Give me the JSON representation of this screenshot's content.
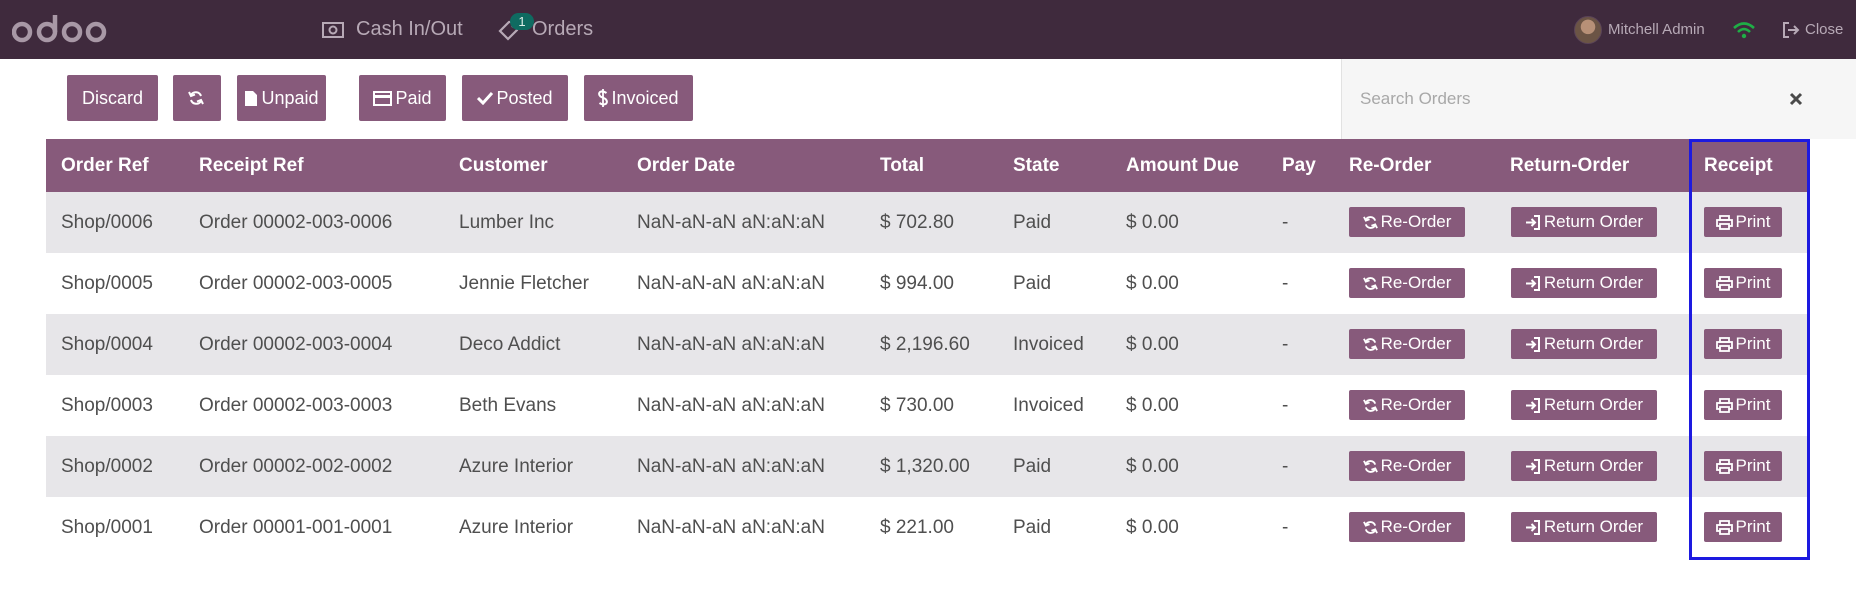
{
  "navbar": {
    "logo_text": "odoo",
    "cash_label": "Cash In/Out",
    "orders_label": "Orders",
    "orders_badge": "1",
    "user_name": "Mitchell Admin",
    "close_label": "Close",
    "colors": {
      "bar": "#3f2a3d",
      "text": "#b7a9b6",
      "wifi": "#1fae46",
      "badge": "#0f6b61"
    }
  },
  "toolbar": {
    "discard_label": "Discard",
    "unpaid_label": "Unpaid",
    "paid_label": "Paid",
    "posted_label": "Posted",
    "invoiced_label": "Invoiced",
    "icons": [
      "refresh-icon",
      "file-icon",
      "credit-card-icon",
      "check-icon",
      "dollar-icon"
    ]
  },
  "search": {
    "placeholder": "Search Orders",
    "value": ""
  },
  "table": {
    "headers": [
      "Order Ref",
      "Receipt Ref",
      "Customer",
      "Order Date",
      "Total",
      "State",
      "Amount Due",
      "Pay",
      "Re-Order",
      "Return-Order",
      "Receipt"
    ],
    "button_labels": {
      "reorder": "Re-Order",
      "return": "Return Order",
      "print": "Print"
    },
    "rows": [
      {
        "order_ref": "Shop/0006",
        "receipt_ref": "Order 00002-003-0006",
        "customer": "Lumber Inc",
        "order_date": "NaN-aN-aN aN:aN:aN",
        "total": "$ 702.80",
        "state": "Paid",
        "amount_due": "$ 0.00",
        "pay": "-"
      },
      {
        "order_ref": "Shop/0005",
        "receipt_ref": "Order 00002-003-0005",
        "customer": "Jennie Fletcher",
        "order_date": "NaN-aN-aN aN:aN:aN",
        "total": "$ 994.00",
        "state": "Paid",
        "amount_due": "$ 0.00",
        "pay": "-"
      },
      {
        "order_ref": "Shop/0004",
        "receipt_ref": "Order 00002-003-0004",
        "customer": "Deco Addict",
        "order_date": "NaN-aN-aN aN:aN:aN",
        "total": "$ 2,196.60",
        "state": "Invoiced",
        "amount_due": "$ 0.00",
        "pay": "-"
      },
      {
        "order_ref": "Shop/0003",
        "receipt_ref": "Order 00002-003-0003",
        "customer": "Beth Evans",
        "order_date": "NaN-aN-aN aN:aN:aN",
        "total": "$ 730.00",
        "state": "Invoiced",
        "amount_due": "$ 0.00",
        "pay": "-"
      },
      {
        "order_ref": "Shop/0002",
        "receipt_ref": "Order 00002-002-0002",
        "customer": "Azure Interior",
        "order_date": "NaN-aN-aN aN:aN:aN",
        "total": "$ 1,320.00",
        "state": "Paid",
        "amount_due": "$ 0.00",
        "pay": "-"
      },
      {
        "order_ref": "Shop/0001",
        "receipt_ref": "Order 00001-001-0001",
        "customer": "Azure Interior",
        "order_date": "NaN-aN-aN aN:aN:aN",
        "total": "$ 221.00",
        "state": "Paid",
        "amount_due": "$ 0.00",
        "pay": "-"
      }
    ],
    "colors": {
      "header": "#875a7b",
      "stripe": "#e7e6e9",
      "button": "#875a7b",
      "highlight": "#1d1ae0"
    }
  }
}
